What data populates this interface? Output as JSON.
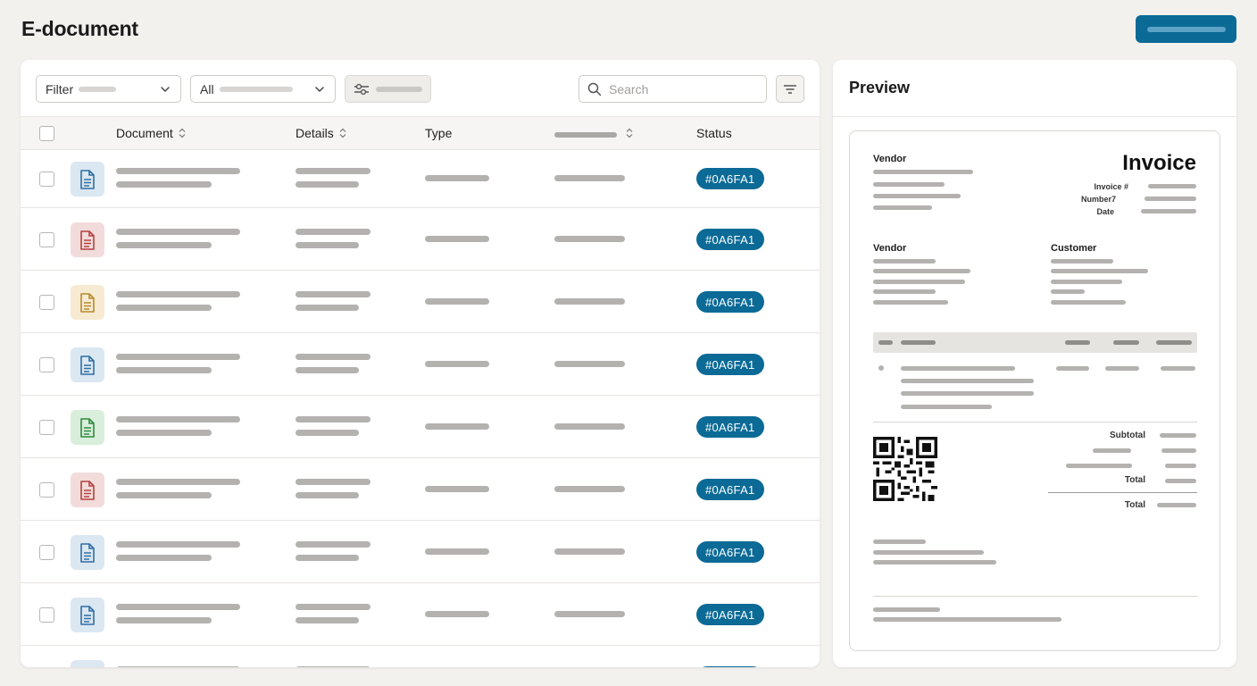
{
  "app": {
    "title": "E-document"
  },
  "toolbar": {
    "filter_label": "Filter",
    "all_label": "All",
    "search_placeholder": "Search",
    "icons": [
      "sliders-icon",
      "search-icon",
      "filter-lines-icon",
      "chevron-down-icon"
    ]
  },
  "table": {
    "columns": [
      "Document",
      "Details",
      "Type",
      "Status"
    ],
    "rows": [
      {
        "icon_color": "#2f6fa5",
        "icon_bg": "#dbe7f1",
        "status": "#0A6FA1"
      },
      {
        "icon_color": "#b5413f",
        "icon_bg": "#f2dcdb",
        "status": "#0A6FA1"
      },
      {
        "icon_color": "#b78a2e",
        "icon_bg": "#f6ead2",
        "status": "#0A6FA1"
      },
      {
        "icon_color": "#2f6fa5",
        "icon_bg": "#dbe7f1",
        "status": "#0A6FA1"
      },
      {
        "icon_color": "#2f8a3e",
        "icon_bg": "#d9eedb",
        "status": "#0A6FA1"
      },
      {
        "icon_color": "#b5413f",
        "icon_bg": "#f2dcdb",
        "status": "#0A6FA1"
      },
      {
        "icon_color": "#2f6fa5",
        "icon_bg": "#dbe7f1",
        "status": "#0A6FA1"
      },
      {
        "icon_color": "#2f6fa5",
        "icon_bg": "#dbe7f1",
        "status": "#0A6FA1"
      }
    ]
  },
  "preview": {
    "title": "Preview",
    "invoice": {
      "heading": "Invoice",
      "vendor_top": "Vendor",
      "invoice_number_label": "Invoice #",
      "number_label": "Number7",
      "date_label": "Date",
      "vendor": "Vendor",
      "customer": "Customer",
      "subtotal": "Subtotal",
      "total": "Total",
      "grand_total": "Total"
    }
  },
  "colors": {
    "accent": "#0b6a96",
    "background": "#f2f1ee"
  }
}
